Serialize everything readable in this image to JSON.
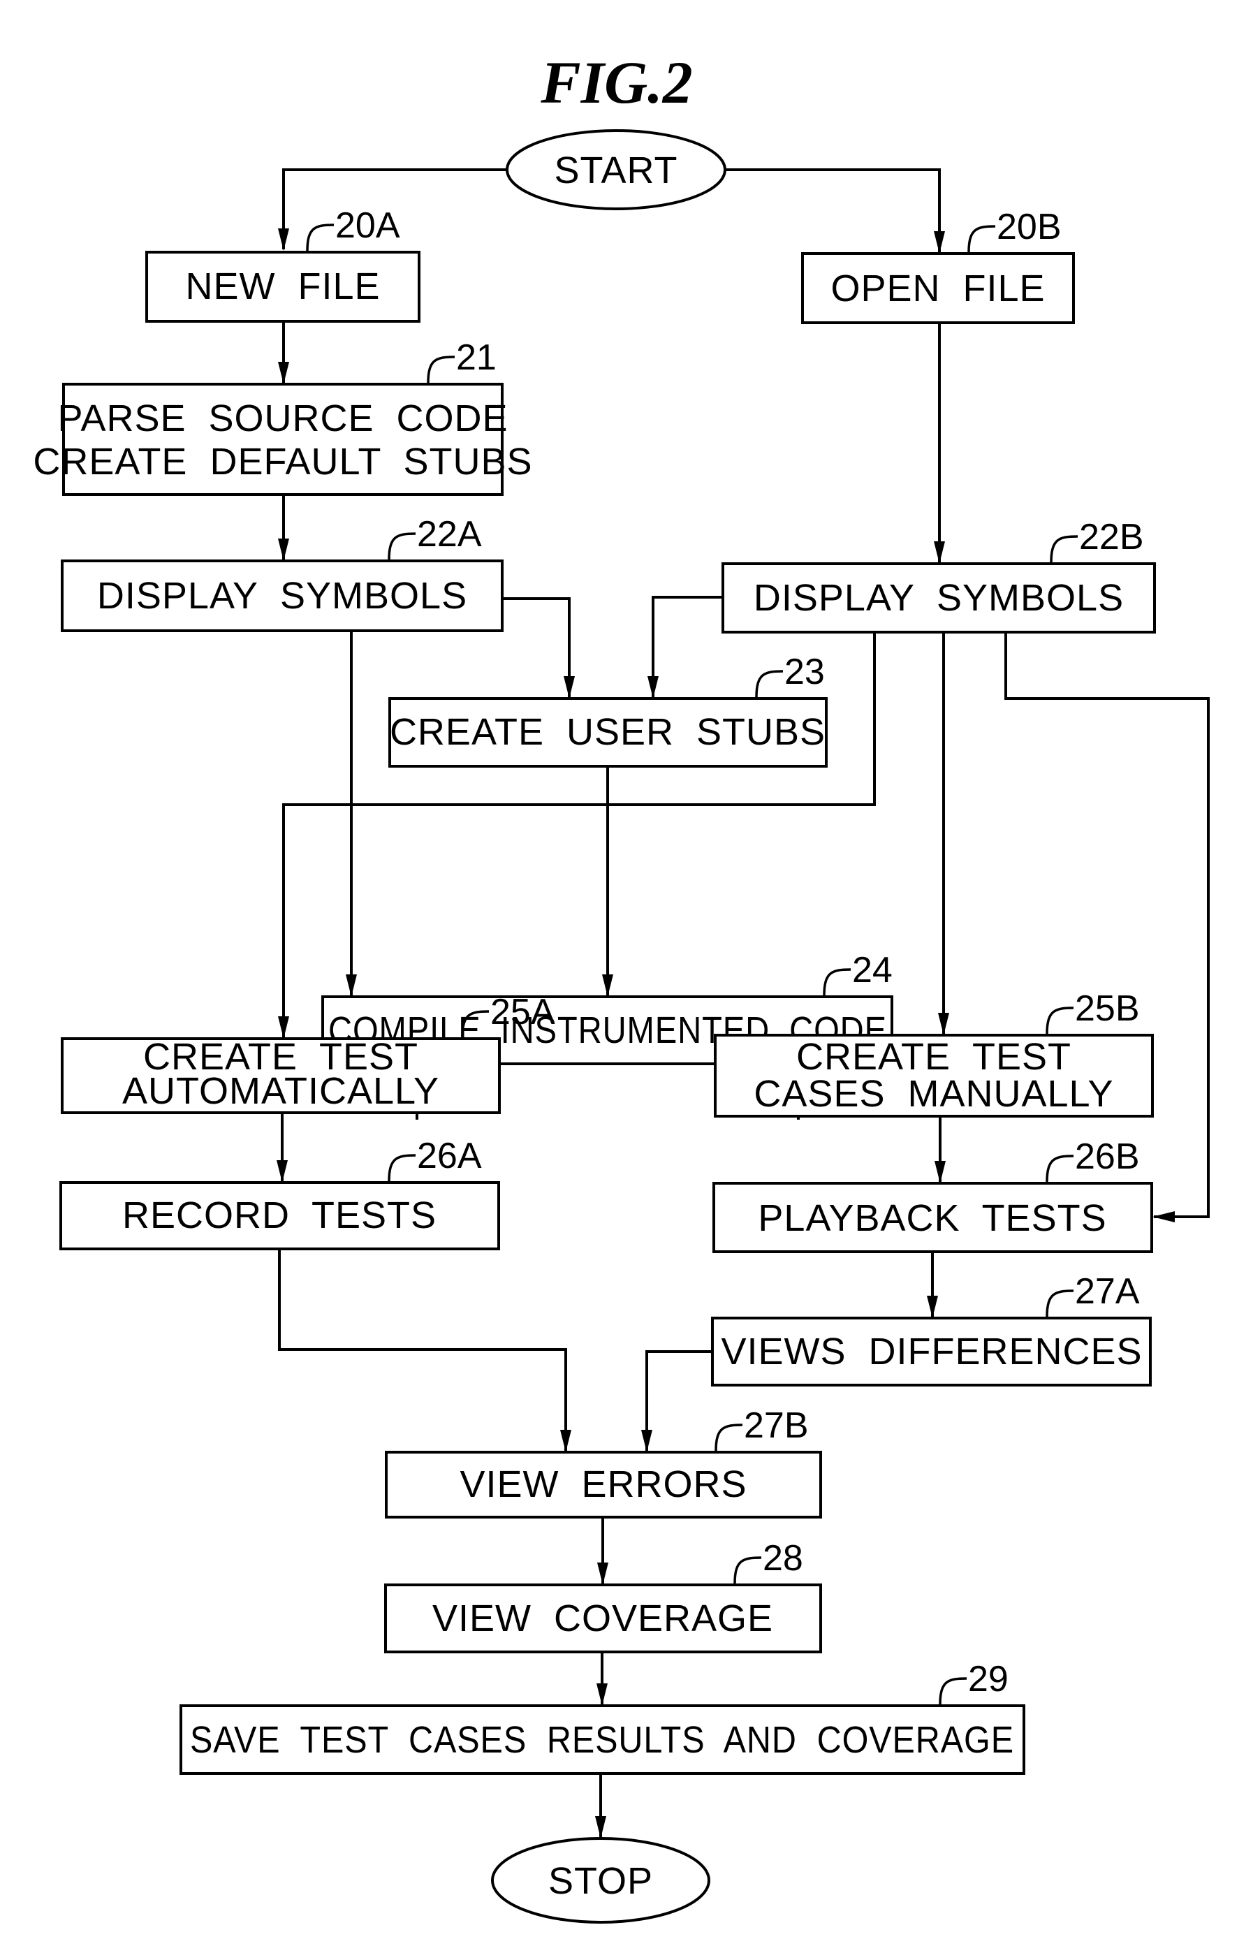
{
  "figure": {
    "title": "FIG.2"
  },
  "nodes": {
    "start": {
      "lines": [
        "START"
      ]
    },
    "n20A": {
      "ref": "20A",
      "lines": [
        "NEW  FILE"
      ]
    },
    "n20B": {
      "ref": "20B",
      "lines": [
        "OPEN  FILE"
      ]
    },
    "n21": {
      "ref": "21",
      "lines": [
        "PARSE  SOURCE  CODE",
        "CREATE  DEFAULT  STUBS"
      ]
    },
    "n22A": {
      "ref": "22A",
      "lines": [
        "DISPLAY  SYMBOLS"
      ]
    },
    "n22B": {
      "ref": "22B",
      "lines": [
        "DISPLAY  SYMBOLS"
      ]
    },
    "n23": {
      "ref": "23",
      "lines": [
        "CREATE  USER  STUBS"
      ]
    },
    "n24": {
      "ref": "24",
      "lines": [
        "COMPILE  INSTRUMENTED  CODE"
      ]
    },
    "n25A": {
      "ref": "25A",
      "lines": [
        "CREATE  TEST",
        "AUTOMATICALLY"
      ]
    },
    "n25B": {
      "ref": "25B",
      "lines": [
        "CREATE  TEST",
        "CASES  MANUALLY"
      ]
    },
    "n26A": {
      "ref": "26A",
      "lines": [
        "RECORD  TESTS"
      ]
    },
    "n26B": {
      "ref": "26B",
      "lines": [
        "PLAYBACK  TESTS"
      ]
    },
    "n27A": {
      "ref": "27A",
      "lines": [
        "VIEWS  DIFFERENCES"
      ]
    },
    "n27B": {
      "ref": "27B",
      "lines": [
        "VIEW  ERRORS"
      ]
    },
    "n28": {
      "ref": "28",
      "lines": [
        "VIEW  COVERAGE"
      ]
    },
    "n29": {
      "ref": "29",
      "lines": [
        "SAVE  TEST  CASES  RESULTS  AND  COVERAGE"
      ]
    },
    "stop": {
      "lines": [
        "STOP"
      ]
    }
  },
  "edges": [
    [
      "start",
      "n20A"
    ],
    [
      "start",
      "n20B"
    ],
    [
      "n20A",
      "n21"
    ],
    [
      "n21",
      "n22A"
    ],
    [
      "n20B",
      "n22B"
    ],
    [
      "n22A",
      "n23"
    ],
    [
      "n22B",
      "n23"
    ],
    [
      "n22A",
      "n24"
    ],
    [
      "n23",
      "n24"
    ],
    [
      "n22B",
      "n25A"
    ],
    [
      "n24",
      "n25A"
    ],
    [
      "n24",
      "n25B"
    ],
    [
      "n22B",
      "n25B"
    ],
    [
      "n22B",
      "n26B"
    ],
    [
      "n25A",
      "n26A"
    ],
    [
      "n25B",
      "n26B"
    ],
    [
      "n26B",
      "n27A"
    ],
    [
      "n26A",
      "n27B"
    ],
    [
      "n27A",
      "n27B"
    ],
    [
      "n27B",
      "n28"
    ],
    [
      "n28",
      "n29"
    ],
    [
      "n29",
      "stop"
    ]
  ]
}
